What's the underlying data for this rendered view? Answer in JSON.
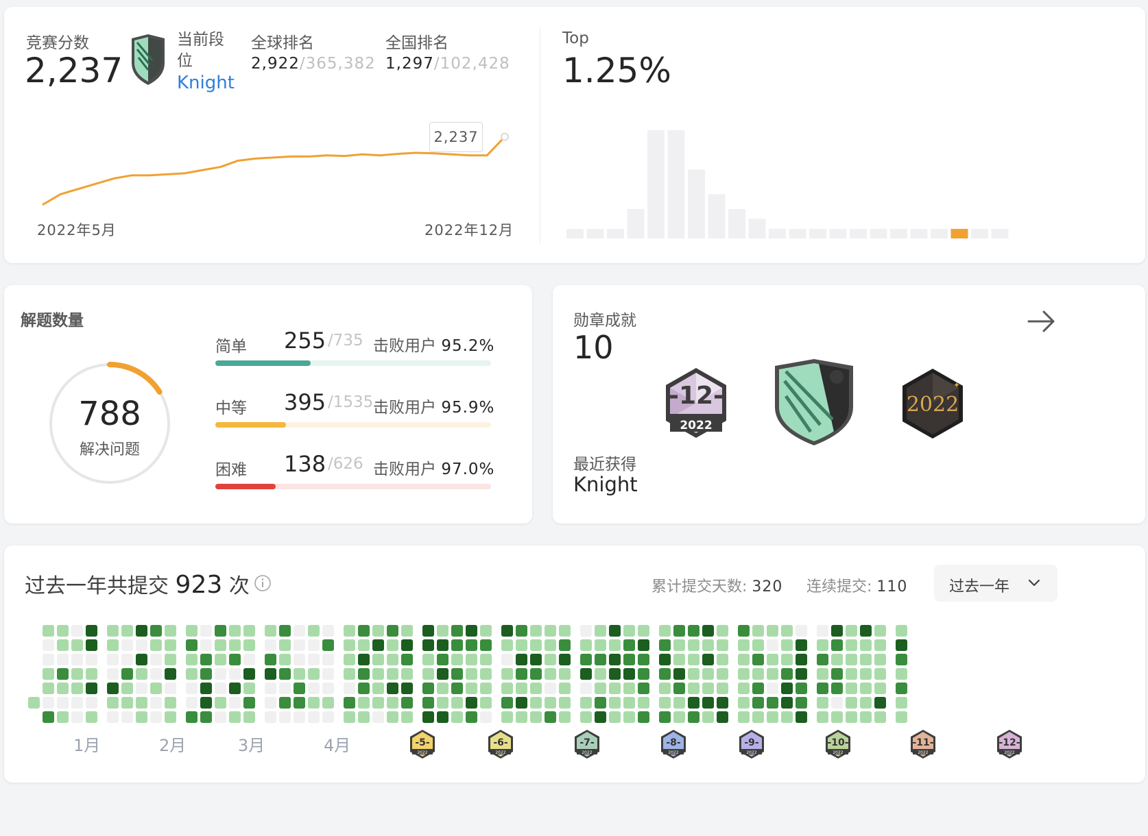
{
  "contest": {
    "score_label": "竞赛分数",
    "score_value": "2,237",
    "tier_label": "当前段位",
    "tier_value": "Knight",
    "global_rank_label": "全球排名",
    "global_rank": "2,922",
    "global_total": "/365,382",
    "national_rank_label": "全国排名",
    "national_rank": "1,297",
    "national_total": "/102,428",
    "chart_start": "2022年5月",
    "chart_end": "2022年12月",
    "tooltip": "2,237",
    "top_label": "Top",
    "top_value": "1.25%"
  },
  "solved": {
    "title": "解题数量",
    "total": "788",
    "total_label": "解决问题",
    "difficulties": [
      {
        "name": "简单",
        "solved": "255",
        "total": "/735",
        "beat_label": "击败用户",
        "beat": "95.2%",
        "ratio": 0.347,
        "color": "#4aa897",
        "track": "#e6f4ef"
      },
      {
        "name": "中等",
        "solved": "395",
        "total": "/1535",
        "beat_label": "击败用户",
        "beat": "95.9%",
        "ratio": 0.257,
        "color": "#f5b73d",
        "track": "#fdf3e1"
      },
      {
        "name": "困难",
        "solved": "138",
        "total": "/626",
        "beat_label": "击败用户",
        "beat": "97.0%",
        "ratio": 0.22,
        "color": "#e0433b",
        "track": "#fbe4e2"
      }
    ],
    "progress_ratio": 0.16
  },
  "badges": {
    "title": "勋章成就",
    "count": "10",
    "recent_label": "最近获得",
    "recent_value": "Knight",
    "arrow_icon": "arrow-right-icon",
    "items": [
      {
        "name": "12-2022-badge",
        "text": "12",
        "year": "2022"
      },
      {
        "name": "knight-badge"
      },
      {
        "name": "2022-annual-badge",
        "text": "2022"
      }
    ]
  },
  "submissions": {
    "title_prefix": "过去一年共提交",
    "count": "923",
    "title_suffix": "次",
    "total_days_label": "累计提交天数:",
    "total_days": "320",
    "streak_label": "连续提交:",
    "streak": "110",
    "range_select": "过去一年",
    "months": [
      "1月",
      "2月",
      "3月",
      "4月"
    ],
    "month_badges": [
      "5",
      "6",
      "7",
      "8",
      "9",
      "10",
      "11",
      "12"
    ],
    "badge_year": "2022",
    "colors": {
      "empty": "#f0f0f0",
      "light": "#a9dba9",
      "medium": "#3a8d3d",
      "dark": "#1b5e20"
    }
  },
  "chart_data": [
    {
      "type": "line",
      "x": [
        "2022年5月",
        "",
        "",
        "",
        "",
        "",
        "",
        "",
        "",
        "",
        "",
        "",
        "",
        "",
        "",
        "",
        "",
        "",
        "",
        "",
        "",
        "",
        "",
        "",
        "",
        "",
        "2022年12月"
      ],
      "values": [
        1590,
        1690,
        1740,
        1790,
        1840,
        1870,
        1870,
        1880,
        1890,
        1920,
        1950,
        2010,
        2030,
        2040,
        2050,
        2050,
        2060,
        2055,
        2070,
        2060,
        2075,
        2085,
        2080,
        2070,
        2060,
        2060,
        2237
      ],
      "series": [
        {
          "name": "",
          "values": [
            1590,
            1690,
            1740,
            1790,
            1840,
            1870,
            1870,
            1880,
            1890,
            1920,
            1950,
            2010,
            2030,
            2040,
            2050,
            2050,
            2060,
            2055,
            2070,
            2060,
            2075,
            2085,
            2080,
            2070,
            2060,
            2060,
            2237
          ]
        }
      ],
      "ylim": [
        1550,
        2300
      ],
      "grid": false
    },
    {
      "type": "bar",
      "values": [
        3,
        3,
        3,
        30,
        110,
        110,
        70,
        45,
        30,
        20,
        10,
        5,
        5,
        5,
        5,
        5,
        5,
        5,
        5,
        5,
        5,
        5
      ],
      "highlight_index": 19,
      "highlight_color": "#f0a132",
      "bar_color": "#f0f0f2"
    }
  ]
}
